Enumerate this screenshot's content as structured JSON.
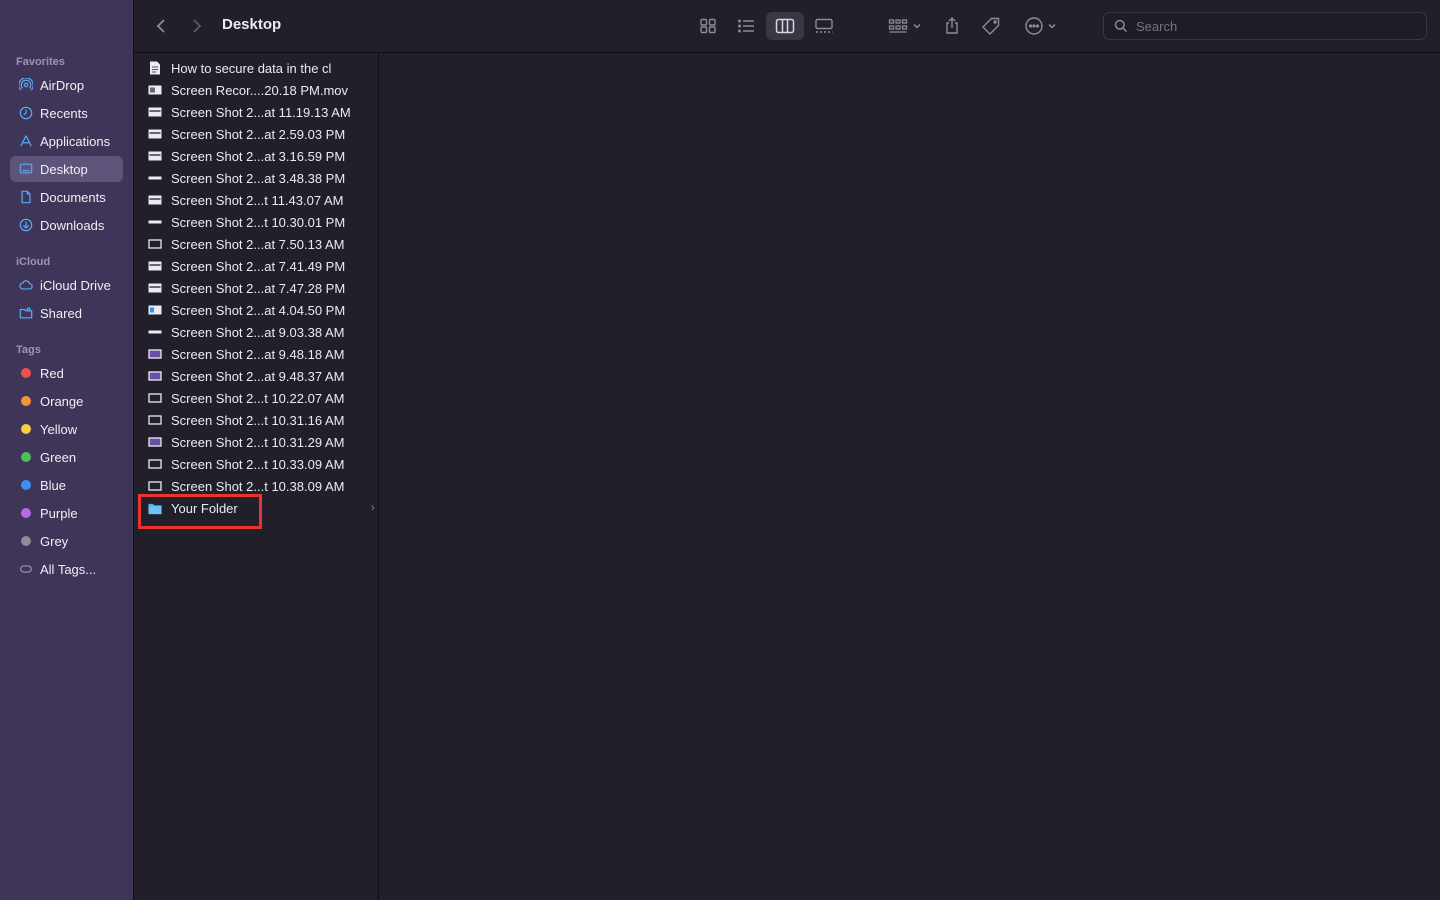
{
  "window": {
    "title": "Desktop"
  },
  "toolbar": {
    "search_placeholder": "Search"
  },
  "sidebar": {
    "favorites_title": "Favorites",
    "favorites": [
      {
        "label": "AirDrop",
        "icon": "airdrop-icon"
      },
      {
        "label": "Recents",
        "icon": "clock-icon"
      },
      {
        "label": "Applications",
        "icon": "applications-icon"
      },
      {
        "label": "Desktop",
        "icon": "desktop-icon",
        "selected": true
      },
      {
        "label": "Documents",
        "icon": "document-icon"
      },
      {
        "label": "Downloads",
        "icon": "downloads-icon"
      }
    ],
    "icloud_title": "iCloud",
    "icloud": [
      {
        "label": "iCloud Drive",
        "icon": "cloud-icon"
      },
      {
        "label": "Shared",
        "icon": "shared-folder-icon"
      }
    ],
    "tags_title": "Tags",
    "tags": [
      {
        "label": "Red",
        "color": "#e8534f"
      },
      {
        "label": "Orange",
        "color": "#f0953a"
      },
      {
        "label": "Yellow",
        "color": "#f4cf3e"
      },
      {
        "label": "Green",
        "color": "#4cc157"
      },
      {
        "label": "Blue",
        "color": "#3b8ff0"
      },
      {
        "label": "Purple",
        "color": "#b66be0"
      },
      {
        "label": "Grey",
        "color": "#8e8d93"
      },
      {
        "label": "All Tags...",
        "color": null
      }
    ]
  },
  "files": [
    {
      "name": "How to secure data in the cl",
      "kind": "document"
    },
    {
      "name": "Screen Recor....20.18 PM.mov",
      "kind": "movie"
    },
    {
      "name": "Screen Shot 2...at 11.19.13 AM",
      "kind": "image"
    },
    {
      "name": "Screen Shot 2...at 2.59.03 PM",
      "kind": "image"
    },
    {
      "name": "Screen Shot 2...at 3.16.59 PM",
      "kind": "image"
    },
    {
      "name": "Screen Shot 2...at 3.48.38 PM",
      "kind": "image-thin"
    },
    {
      "name": "Screen Shot 2...t 11.43.07 AM",
      "kind": "image"
    },
    {
      "name": "Screen Shot 2...t 10.30.01 PM",
      "kind": "image-thin"
    },
    {
      "name": "Screen Shot 2...at 7.50.13 AM",
      "kind": "image-outline"
    },
    {
      "name": "Screen Shot 2...at 7.41.49 PM",
      "kind": "image"
    },
    {
      "name": "Screen Shot 2...at 7.47.28 PM",
      "kind": "image"
    },
    {
      "name": "Screen Shot 2...at 4.04.50 PM",
      "kind": "image-blue"
    },
    {
      "name": "Screen Shot 2...at 9.03.38 AM",
      "kind": "image-thin"
    },
    {
      "name": "Screen Shot 2...at 9.48.18 AM",
      "kind": "image-purple"
    },
    {
      "name": "Screen Shot 2...at 9.48.37 AM",
      "kind": "image-purple"
    },
    {
      "name": "Screen Shot 2...t 10.22.07 AM",
      "kind": "image-outline"
    },
    {
      "name": "Screen Shot 2...t 10.31.16 AM",
      "kind": "image-outline"
    },
    {
      "name": "Screen Shot 2...t 10.31.29 AM",
      "kind": "image-purple"
    },
    {
      "name": "Screen Shot 2...t 10.33.09 AM",
      "kind": "image-outline"
    },
    {
      "name": "Screen Shot 2...t 10.38.09 AM",
      "kind": "image-outline"
    },
    {
      "name": "Your Folder",
      "kind": "folder",
      "highlighted": true
    }
  ],
  "colors": {
    "highlight": "#e8332e",
    "folder": "#4ab0ee",
    "sidebar_bg": "#3f3559",
    "window_bg": "#221f2a"
  }
}
